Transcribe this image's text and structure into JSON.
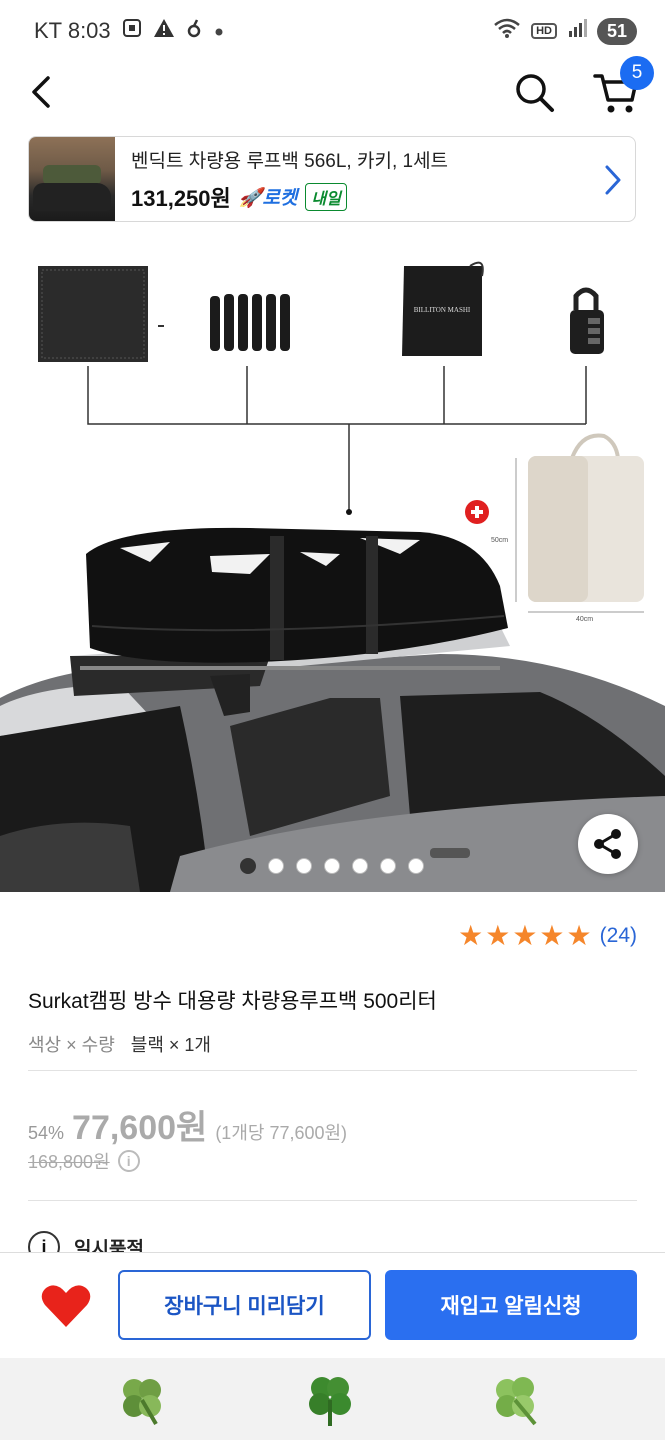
{
  "status_bar": {
    "carrier_time": "KT 8:03",
    "hd": "HD",
    "battery": "51"
  },
  "header": {
    "cart_count": "5"
  },
  "promo": {
    "title": "벤딕트 차량용 루프백 566L, 카키, 1세트",
    "price": "131,250원",
    "rocket_label": "🚀로켓",
    "delivery_label": "내일"
  },
  "product_image": {
    "bag_brand": "BILLITON MASHI",
    "dim_height": "50cm",
    "dim_width": "40cm",
    "slide_count": 7,
    "active_slide": 1
  },
  "rating": {
    "stars": 5,
    "review_count": "(24)"
  },
  "product": {
    "title": "Surkat캠핑 방수 대용량 차량용루프백 500리터",
    "option_label": "색상 × 수량",
    "option_value": "블랙 × 1개"
  },
  "price": {
    "discount": "54%",
    "sale_price": "77,600원",
    "unit_price": "(1개당 77,600원)",
    "original_price": "168,800원"
  },
  "stock": {
    "status": "일시품절"
  },
  "bottom_bar": {
    "cart_button": "장바구니 미리담기",
    "restock_button": "재입고 알림신청"
  },
  "colors": {
    "accent": "#2a6ff0",
    "star": "#f5862b",
    "badge": "#1b6cf2"
  }
}
